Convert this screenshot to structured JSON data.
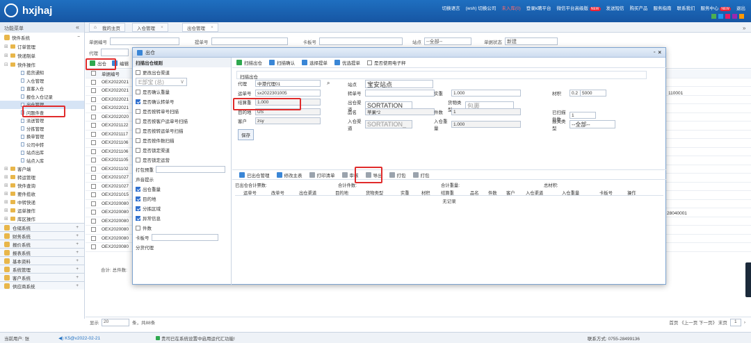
{
  "app": {
    "title": "hxjhaj",
    "links": [
      "切换语言",
      "(wsh) 切换公司",
      "未入库(0)",
      "登录k聘平台",
      "微信平台高级版",
      "发送短信",
      "购买产品",
      "服务指南",
      "联系我们",
      "服务中心",
      "退出"
    ],
    "badge": "NEW"
  },
  "sidebar": {
    "title": "功能菜单",
    "top_group": "快件系统",
    "groups_before": [
      "订单管理",
      "快递制单"
    ],
    "open_group": "快件操作",
    "items": [
      "揽货通知",
      "入仓管理",
      "直客入仓",
      "报仓入仓记录",
      "出仓管理",
      "问题件查",
      "派送管理",
      "分拣管理",
      "换单管理",
      "公司中转",
      "站点出库",
      "站点入库"
    ],
    "groups_after": [
      "客户端",
      "转运管理",
      "快件查询",
      "要件揽收",
      "中转快递",
      "运单操作",
      "库区操作"
    ],
    "systems": [
      "仓储系统",
      "财务系统",
      "报价系统",
      "报表系统",
      "基本资料",
      "系统管理",
      "客户系统",
      "供应商系统"
    ]
  },
  "tabs": [
    "我的主页",
    "入仓管理",
    "出仓管理"
  ],
  "filters": {
    "waybill_label": "单据编号",
    "bill_label": "提单号",
    "card_label": "卡板号",
    "station_label": "站点",
    "station_value": "--全部--",
    "status_label": "单据状态",
    "status_value": "新建",
    "agent_label": "代理"
  },
  "list": {
    "toolbar": [
      "出仓",
      "编辑"
    ],
    "header": "单据编号",
    "rows": [
      "OEX2022021",
      "OEX2022021",
      "OEX2022021",
      "OEX2022021",
      "OEX2022020",
      "OEX2021122",
      "OEX2021117",
      "OEX2021106",
      "OEX2021106",
      "OEX2021105",
      "OEX2021102",
      "OEX2021027",
      "OEX2021027",
      "OEX2021015",
      "OEX2020080",
      "OEX2020080",
      "OEX2020080",
      "OEX2020080",
      "OEX2020080",
      "OEX2020080"
    ],
    "total": "合计: 总件数:",
    "right_values": [
      "110001",
      "28040001"
    ]
  },
  "pager": {
    "show_label": "显示",
    "page_size": "20",
    "summary": "条，共88条",
    "nav": "首页 《上一页 下一页》 末页",
    "page": "1"
  },
  "footer": {
    "user": "当前用户: 张",
    "version": "K5@v2022-02-21",
    "notice": "贵司已在系统设置中启用运代汇功能!",
    "contact": "联系方式: 0755-28499136"
  },
  "modal": {
    "title": "出仓",
    "left_title": "扫描出仓规则",
    "left_options": [
      {
        "t": "更改出仓渠道",
        "on": false
      },
      {
        "t": "E部宝 (总)",
        "on": false,
        "select": true
      },
      {
        "t": "是否确认重量",
        "on": false
      },
      {
        "t": "是否确认转单号",
        "on": true
      },
      {
        "t": "是否按转单号扫描",
        "on": false
      },
      {
        "t": "是否按客户运单号扫描",
        "on": false
      },
      {
        "t": "是否按转运单号扫描",
        "on": false
      },
      {
        "t": "是否按件数扫描",
        "on": false
      },
      {
        "t": "是否锁定渠道",
        "on": false
      },
      {
        "t": "是否锁定运营",
        "on": false
      }
    ],
    "pack_label": "打包预重",
    "sound_label": "声音提示",
    "sound_options": [
      {
        "t": "出仓重量",
        "on": true
      },
      {
        "t": "目的地",
        "on": true
      },
      {
        "t": "分拣区域",
        "on": true
      },
      {
        "t": "异常信息",
        "on": true
      },
      {
        "t": "件数",
        "on": false
      }
    ],
    "card_label": "卡板号",
    "branch_label": "分货代理",
    "toolbar": [
      "扫描出仓",
      "扫描确认",
      "选择提单",
      "优选提单",
      "是否使用电子秤"
    ],
    "section": "扫描出仓",
    "fields": {
      "agent_l": "代理",
      "agent_v": "中港代理01",
      "station_l": "站点",
      "station_v": "宝安站点",
      "bill_l": "运单号",
      "bill_v": "sx2022301005",
      "trans_l": "转单号",
      "actual_l": "实重",
      "actual_v": "1.000",
      "volume_l": "材积",
      "vol1": "0.2",
      "vol2": "5000",
      "settle_l": "结算重",
      "settle_v": "1.000",
      "channel_l": "出仓渠道",
      "channel_v": "SORTATION_",
      "goods_l": "货物类型",
      "goods_v": "包裹",
      "dest_l": "目的地",
      "dest_v": "US",
      "product_l": "品名",
      "product_v": "苹果*2",
      "pcs_l": "件数",
      "pcs_v": "1",
      "scanned_l": "已扫描件数",
      "scanned_v": "1",
      "cust_l": "客户",
      "cust_v": "zsy",
      "in_l": "入仓渠道",
      "in_v": "SORTATION_",
      "inw_l": "入仓重量",
      "inw_v": "1.000",
      "decl_l": "报关类型",
      "decl_v": "--全部--",
      "save": "保存"
    },
    "bottom_toolbar": [
      "已出仓管理",
      "修改主表",
      "打印清单",
      "审核",
      "导出",
      "打包",
      "打包"
    ],
    "summary": [
      "已出仓合计票数:",
      "合计件数:",
      "合计重量:",
      "总材积:"
    ],
    "columns": [
      "运单号",
      "改单号",
      "出仓渠道",
      "目的地",
      "货物类型",
      "实重",
      "材积",
      "结算重",
      "品名",
      "件数",
      "客户",
      "入仓渠道",
      "入仓重量",
      "卡板号",
      "操作"
    ],
    "empty": "无记录"
  }
}
